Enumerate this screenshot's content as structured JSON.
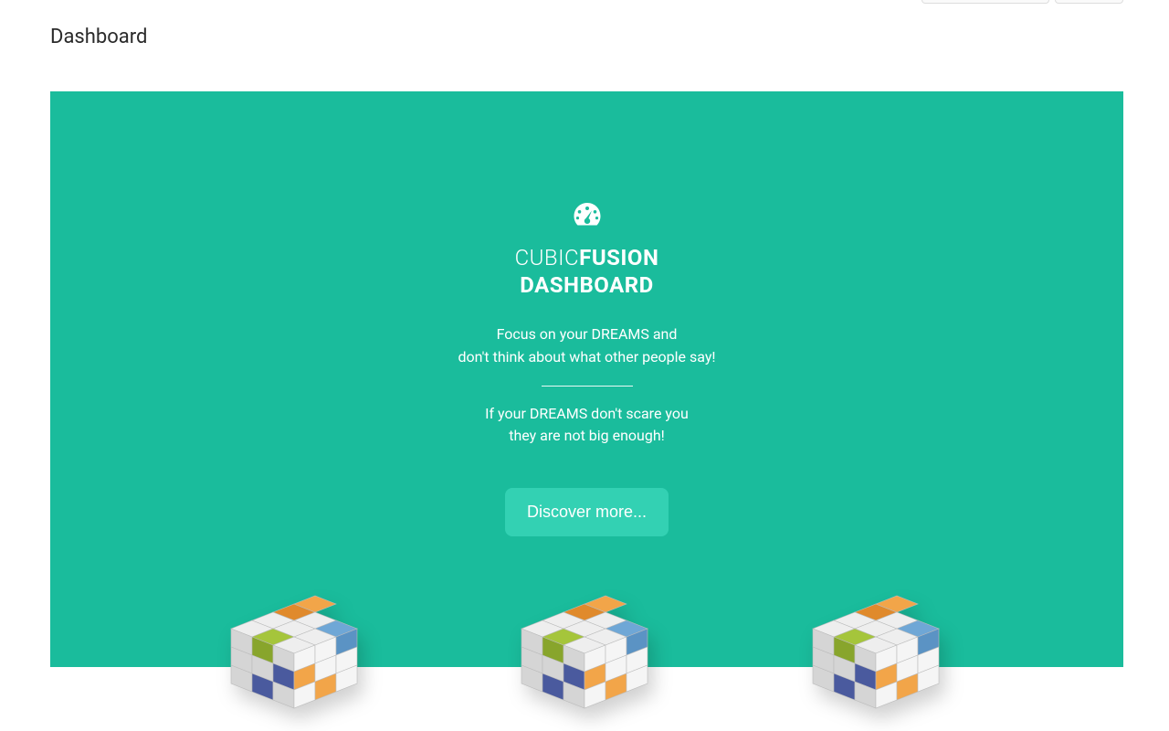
{
  "page": {
    "title": "Dashboard"
  },
  "hero": {
    "brand_thin": "CUBIC",
    "brand_bold": "FUSION",
    "brand_sub": "DASHBOARD",
    "quote1_line1": "Focus on your DREAMS and",
    "quote1_line2": "don't think about what other people say!",
    "quote2_line1": "If your DREAMS don't scare you",
    "quote2_line2": "they are not big enough!",
    "cta_label": "Discover more..."
  },
  "colors": {
    "hero_bg": "#1abc9c",
    "cta_bg": "#33d1b3"
  }
}
